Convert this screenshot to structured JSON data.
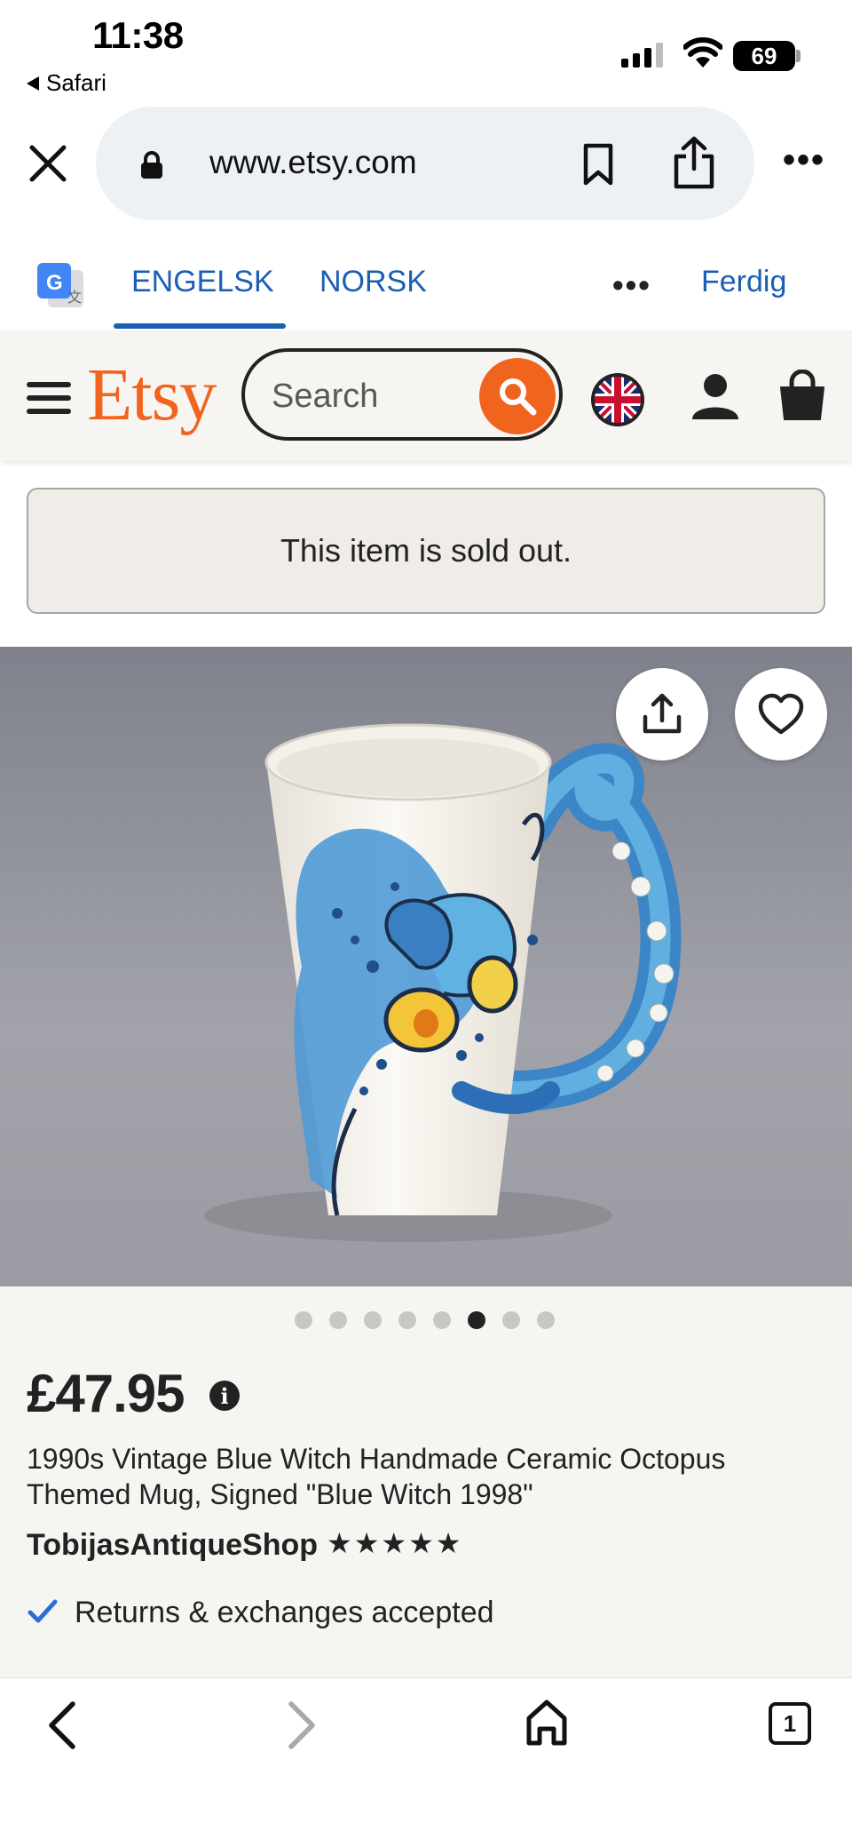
{
  "status_bar": {
    "time": "11:38",
    "back_app": "Safari",
    "battery": "69"
  },
  "browser": {
    "url": "www.etsy.com",
    "icons": [
      "close-icon",
      "lock-icon",
      "bookmark-icon",
      "share-icon",
      "more-icon"
    ]
  },
  "translate": {
    "tab_source": "ENGELSK",
    "tab_target": "NORSK",
    "more": "•••",
    "done": "Ferdig"
  },
  "etsy_header": {
    "logo": "Etsy",
    "search_placeholder": "Search"
  },
  "notice": {
    "sold_out": "This item is sold out."
  },
  "gallery": {
    "slide_count": 8,
    "active_index": 5
  },
  "product": {
    "price": "£47.95",
    "info": "i",
    "title_line1": "1990s Vintage Blue Witch Handmade Ceramic Octopus",
    "title_line2": "Themed Mug, Signed \"Blue Witch 1998\"",
    "shop_name": "TobijasAntiqueShop",
    "stars": "★★★★★",
    "returns": "Returns & exchanges accepted"
  },
  "toolbar": {
    "tab_count": "1"
  },
  "colors": {
    "etsy_orange": "#f1641e",
    "link_blue": "#1a5fb4",
    "header_bg": "#f7f5f2"
  }
}
